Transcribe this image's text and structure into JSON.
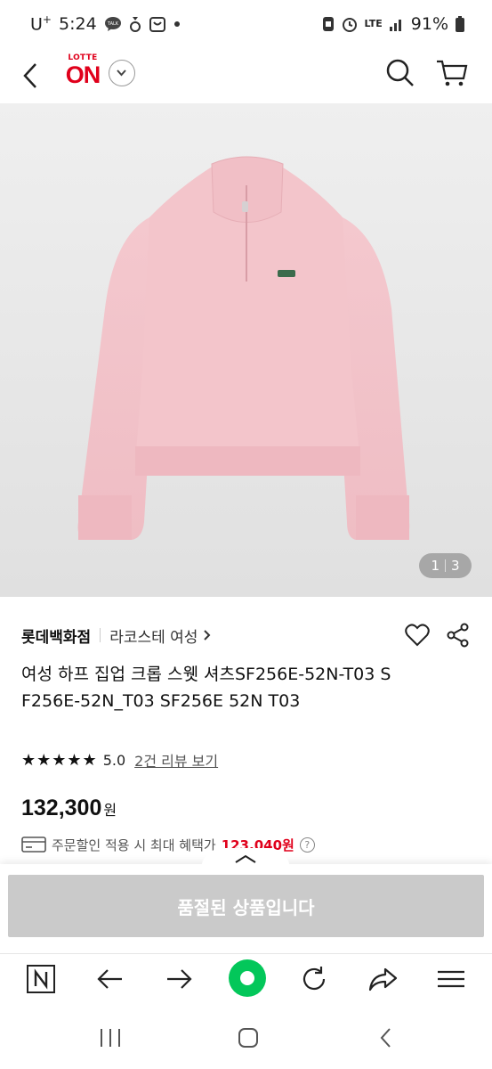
{
  "status_bar": {
    "carrier": "U",
    "carrier_sup": "+",
    "time": "5:24",
    "talk_label": "TALK",
    "network": "LTE",
    "battery": "91%"
  },
  "header": {
    "logo_top": "LOTTE",
    "logo_main": "ON"
  },
  "gallery": {
    "current": "1",
    "total": "3"
  },
  "product": {
    "store": "롯데백화점",
    "brand": "라코스테 여성",
    "title": "여성 하프 집업 크롭 스웻 셔츠SF256E-52N-T03 SF256E-52N_T03 SF256E 52N T03",
    "stars": "★★★★★",
    "rating": "5.0",
    "review_link": "2건 리뷰 보기",
    "price": "132,300",
    "currency": "원",
    "discount_label": "주문할인 적용 시 최대 혜택가",
    "discount_price": "123,040원"
  },
  "purchase": {
    "soldout_label": "품절된 상품입니다"
  },
  "colors": {
    "brand_red": "#e0001b",
    "garment_pink": "#f2c3c9",
    "soldout_gray": "#cacaca",
    "naver_green": "#03c75a"
  }
}
